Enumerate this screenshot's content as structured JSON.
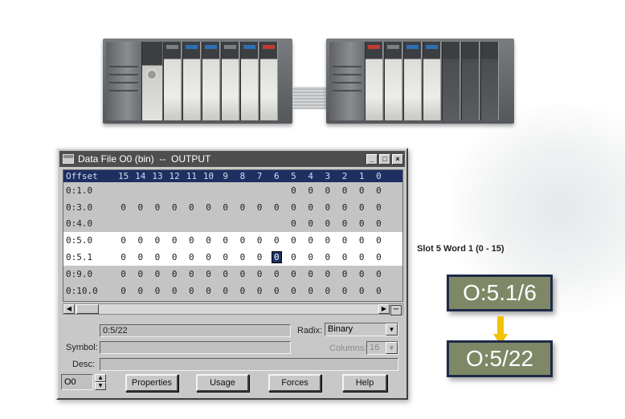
{
  "window": {
    "title": "Data File O0 (bin)  --  OUTPUT",
    "buttons": {
      "minimize": "_",
      "maximize": "□",
      "close": "×"
    }
  },
  "grid": {
    "headers": [
      "Offset",
      "15",
      "14",
      "13",
      "12",
      "11",
      "10",
      "9",
      "8",
      "7",
      "6",
      "5",
      "4",
      "3",
      "2",
      "1",
      "0"
    ],
    "rows": [
      {
        "addr": "0:1.0",
        "bits": [
          "",
          "",
          "",
          "",
          "",
          "",
          "",
          "",
          "",
          "",
          "0",
          "0",
          "0",
          "0",
          "0",
          "0"
        ],
        "highlight": false
      },
      {
        "addr": "0:3.0",
        "bits": [
          "0",
          "0",
          "0",
          "0",
          "0",
          "0",
          "0",
          "0",
          "0",
          "0",
          "0",
          "0",
          "0",
          "0",
          "0",
          "0"
        ],
        "highlight": false
      },
      {
        "addr": "0:4.0",
        "bits": [
          "",
          "",
          "",
          "",
          "",
          "",
          "",
          "",
          "",
          "",
          "0",
          "0",
          "0",
          "0",
          "0",
          "0"
        ],
        "highlight": false
      },
      {
        "addr": "0:5.0",
        "bits": [
          "0",
          "0",
          "0",
          "0",
          "0",
          "0",
          "0",
          "0",
          "0",
          "0",
          "0",
          "0",
          "0",
          "0",
          "0",
          "0"
        ],
        "highlight": true
      },
      {
        "addr": "0:5.1",
        "bits": [
          "0",
          "0",
          "0",
          "0",
          "0",
          "0",
          "0",
          "0",
          "0",
          "0",
          "0",
          "0",
          "0",
          "0",
          "0",
          "0"
        ],
        "highlight": true
      },
      {
        "addr": "0:9.0",
        "bits": [
          "0",
          "0",
          "0",
          "0",
          "0",
          "0",
          "0",
          "0",
          "0",
          "0",
          "0",
          "0",
          "0",
          "0",
          "0",
          "0"
        ],
        "highlight": false
      },
      {
        "addr": "0:10.0",
        "bits": [
          "0",
          "0",
          "0",
          "0",
          "0",
          "0",
          "0",
          "0",
          "0",
          "0",
          "0",
          "0",
          "0",
          "0",
          "0",
          "0"
        ],
        "highlight": false
      }
    ],
    "selected": {
      "row": 4,
      "bit_column": 9
    }
  },
  "footer": {
    "address_value": "0:5/22",
    "radix_label": "Radix:",
    "radix_value": "Binary",
    "symbol_label": "Symbol:",
    "columns_label": "Columns:",
    "columns_value": "16",
    "desc_label": "Desc:",
    "file_value": "O0",
    "buttons": {
      "properties": "Properties",
      "usage": "Usage",
      "forces": "Forces",
      "help": "Help"
    }
  },
  "annotation": {
    "slot_caption": "Slot 5 Word 1 (0 - 15)",
    "bit_address": "O:5.1/6",
    "word_address": "O:5/22"
  },
  "colors": {
    "title_bar": "#4e4e4e",
    "grid_header": "#1e2f62",
    "address_box": "#7e8866",
    "arrow": "#f2c200"
  }
}
